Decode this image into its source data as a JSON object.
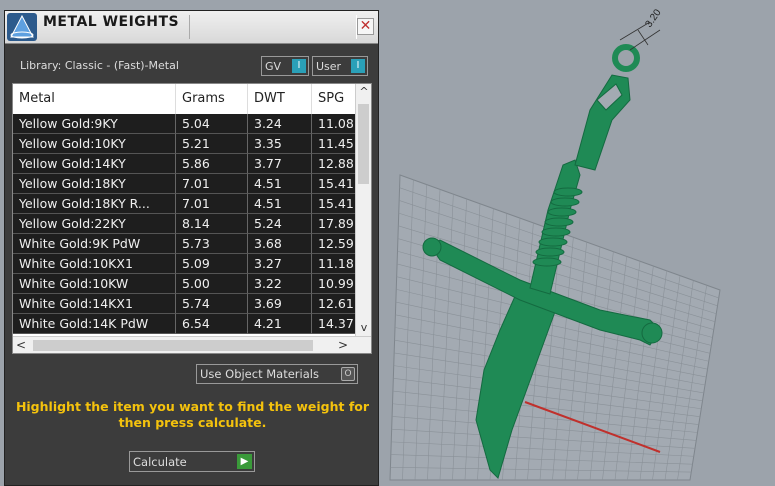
{
  "panel": {
    "title": "METAL WEIGHTS",
    "close_glyph": "✕",
    "library_label": "Library: Classic - (Fast)-Metal",
    "toggles": {
      "gv_label": "GV",
      "user_label": "User",
      "knob_glyph": "I"
    },
    "table": {
      "columns": [
        "Metal",
        "Grams",
        "DWT",
        "SPG"
      ],
      "rows": [
        [
          "Yellow Gold:9KY",
          "5.04",
          "3.24",
          "11.08"
        ],
        [
          "Yellow Gold:10KY",
          "5.21",
          "3.35",
          "11.45"
        ],
        [
          "Yellow Gold:14KY",
          "5.86",
          "3.77",
          "12.88"
        ],
        [
          "Yellow Gold:18KY",
          "7.01",
          "4.51",
          "15.41"
        ],
        [
          "Yellow Gold:18KY R...",
          "7.01",
          "4.51",
          "15.41"
        ],
        [
          "Yellow Gold:22KY",
          "8.14",
          "5.24",
          "17.89"
        ],
        [
          "White Gold:9K PdW",
          "5.73",
          "3.68",
          "12.59"
        ],
        [
          "White Gold:10KX1",
          "5.09",
          "3.27",
          "11.18"
        ],
        [
          "White Gold:10KW",
          "5.00",
          "3.22",
          "10.99"
        ],
        [
          "White Gold:14KX1",
          "5.74",
          "3.69",
          "12.61"
        ],
        [
          "White Gold:14K PdW",
          "6.54",
          "4.21",
          "14.37"
        ]
      ],
      "scroll_up": "^",
      "scroll_down": "v",
      "scroll_left": "<",
      "scroll_right": ">"
    },
    "use_object_materials": "Use Object Materials",
    "use_object_materials_knob": "O",
    "hint": "Highlight the item you want to find the weight for then press calculate.",
    "calculate_label": "Calculate",
    "calculate_glyph": "▶"
  },
  "viewport": {
    "dimension_label": "3.20",
    "model_color": "#1f8a55",
    "grid_color": "#7f868d",
    "axis_x_color": "#c0302c"
  }
}
